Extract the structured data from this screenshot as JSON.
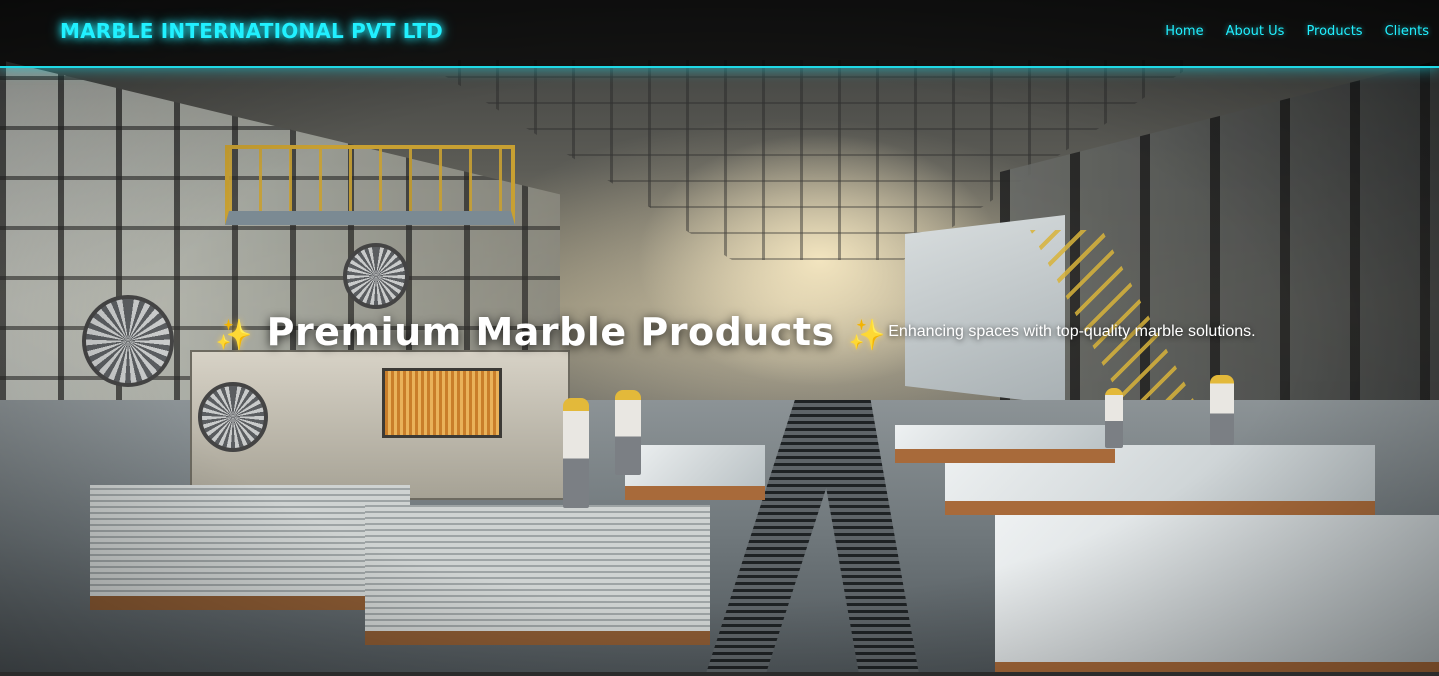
{
  "header": {
    "brand": "MARBLE INTERNATIONAL PVT LTD",
    "nav": [
      {
        "label": "Home"
      },
      {
        "label": "About Us"
      },
      {
        "label": "Products"
      },
      {
        "label": "Clients"
      }
    ]
  },
  "hero": {
    "sparkle_left": "✨",
    "title": "Premium Marble Products",
    "sparkle_right": "✨",
    "subtitle": "Enhancing spaces with top-quality marble solutions."
  },
  "colors": {
    "accent": "#21f0ff",
    "nav_background": "#000000",
    "title_text": "#ffffff",
    "sparkle": "#ffd54a"
  },
  "icons": [
    "sparkle-icon"
  ]
}
